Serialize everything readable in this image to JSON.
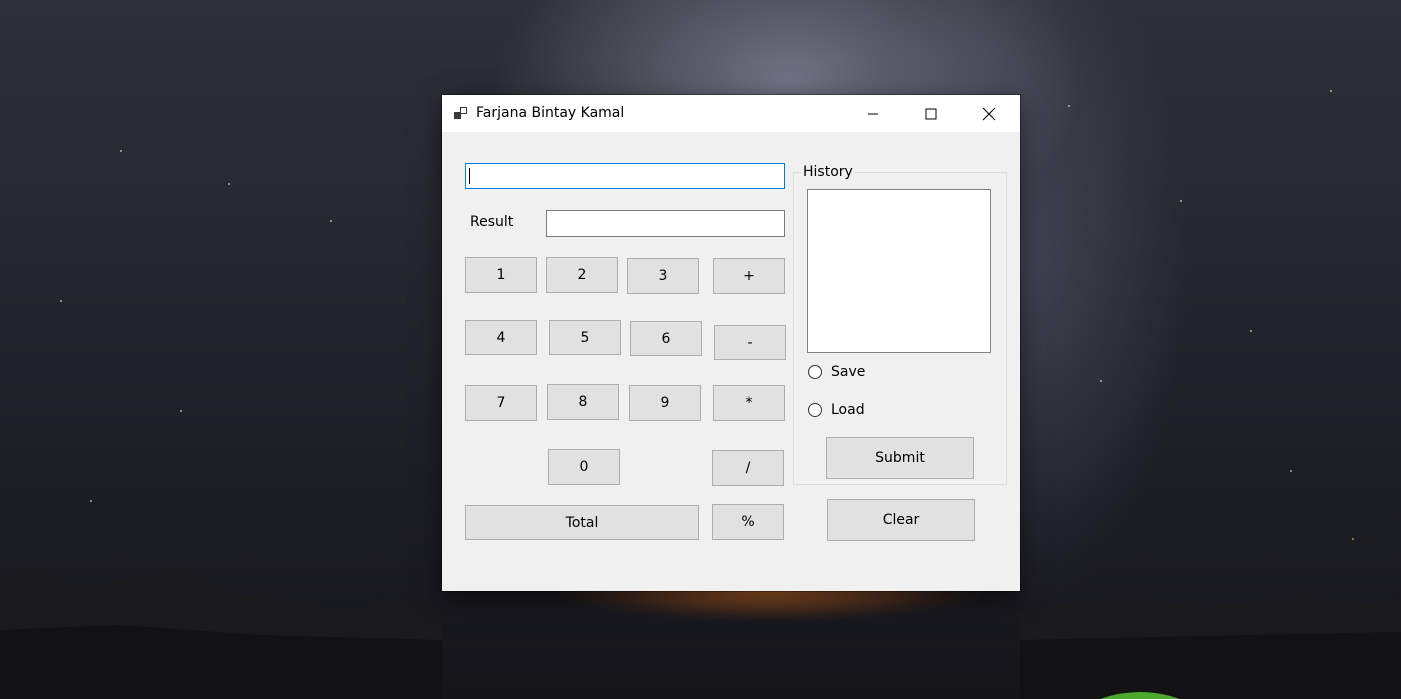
{
  "window": {
    "title": "Farjana Bintay Kamal",
    "caption_icons": [
      "app-icon",
      "minimize-icon",
      "maximize-icon",
      "close-icon"
    ]
  },
  "calculator": {
    "expression_value": "",
    "result_label": "Result",
    "result_value": "",
    "buttons": {
      "one": "1",
      "two": "2",
      "three": "3",
      "plus": "+",
      "four": "4",
      "five": "5",
      "six": "6",
      "minus": "-",
      "seven": "7",
      "eight": "8",
      "nine": "9",
      "multiply": "*",
      "zero": "0",
      "divide": "/",
      "total": "Total",
      "percent": "%"
    }
  },
  "history": {
    "label": "History",
    "items": [],
    "options": [
      {
        "label": "Save",
        "selected": false
      },
      {
        "label": "Load",
        "selected": false
      }
    ],
    "submit_label": "Submit"
  },
  "clear_label": "Clear"
}
